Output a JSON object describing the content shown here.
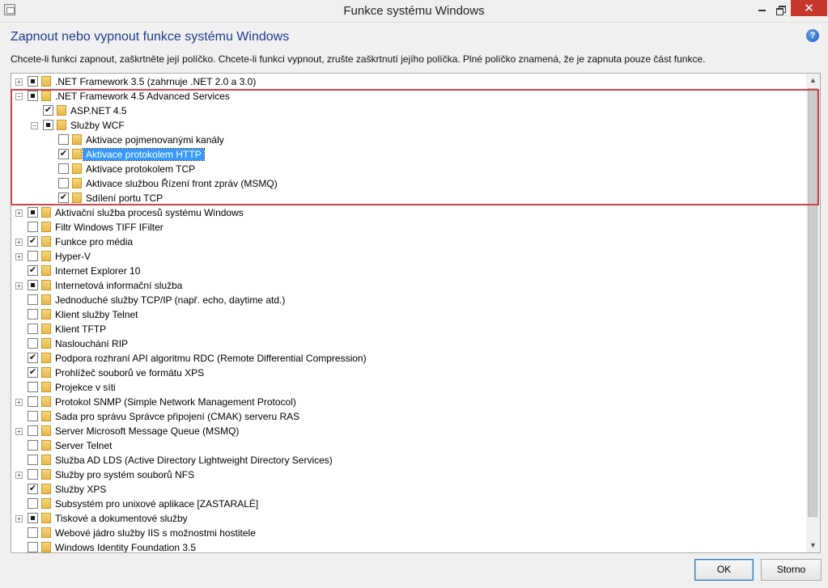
{
  "window": {
    "title": "Funkce systému Windows",
    "close_glyph": "✕"
  },
  "heading": "Zapnout nebo vypnout funkce systému Windows",
  "description": "Chcete-li funkci zapnout, zaškrtněte její políčko. Chcete-li funkci vypnout, zrušte zaškrtnutí jejího políčka. Plné políčko znamená, že je zapnuta pouze část funkce.",
  "help_glyph": "?",
  "tree": {
    "items": [
      {
        "label": ".NET Framework 3.5 (zahrnuje .NET 2.0 a 3.0)",
        "level": 0,
        "expander": "plus",
        "state": "partial"
      },
      {
        "label": ".NET Framework 4.5 Advanced Services",
        "level": 0,
        "expander": "minus",
        "state": "partial"
      },
      {
        "label": "ASP.NET 4.5",
        "level": 1,
        "expander": "none",
        "state": "checked"
      },
      {
        "label": "Služby WCF",
        "level": 1,
        "expander": "minus",
        "state": "partial"
      },
      {
        "label": "Aktivace pojmenovanými kanály",
        "level": 2,
        "expander": "none",
        "state": "unchecked"
      },
      {
        "label": "Aktivace protokolem HTTP",
        "level": 2,
        "expander": "none",
        "state": "checked",
        "selected": true
      },
      {
        "label": "Aktivace protokolem TCP",
        "level": 2,
        "expander": "none",
        "state": "unchecked"
      },
      {
        "label": "Aktivace službou Řízení front zpráv (MSMQ)",
        "level": 2,
        "expander": "none",
        "state": "unchecked"
      },
      {
        "label": "Sdílení portu TCP",
        "level": 2,
        "expander": "none",
        "state": "checked"
      },
      {
        "label": "Aktivační služba procesů systému Windows",
        "level": 0,
        "expander": "plus",
        "state": "partial"
      },
      {
        "label": "Filtr Windows TIFF IFilter",
        "level": 0,
        "expander": "none",
        "state": "unchecked"
      },
      {
        "label": "Funkce pro média",
        "level": 0,
        "expander": "plus",
        "state": "checked"
      },
      {
        "label": "Hyper-V",
        "level": 0,
        "expander": "plus",
        "state": "unchecked"
      },
      {
        "label": "Internet Explorer 10",
        "level": 0,
        "expander": "none",
        "state": "checked"
      },
      {
        "label": "Internetová informační služba",
        "level": 0,
        "expander": "plus",
        "state": "partial"
      },
      {
        "label": "Jednoduché služby TCP/IP (např. echo, daytime atd.)",
        "level": 0,
        "expander": "none",
        "state": "unchecked"
      },
      {
        "label": "Klient služby Telnet",
        "level": 0,
        "expander": "none",
        "state": "unchecked"
      },
      {
        "label": "Klient TFTP",
        "level": 0,
        "expander": "none",
        "state": "unchecked"
      },
      {
        "label": "Naslouchání RIP",
        "level": 0,
        "expander": "none",
        "state": "unchecked"
      },
      {
        "label": "Podpora rozhraní API algoritmu RDC (Remote Differential Compression)",
        "level": 0,
        "expander": "none",
        "state": "checked"
      },
      {
        "label": "Prohlížeč souborů ve formátu XPS",
        "level": 0,
        "expander": "none",
        "state": "checked"
      },
      {
        "label": "Projekce v síti",
        "level": 0,
        "expander": "none",
        "state": "unchecked"
      },
      {
        "label": "Protokol SNMP (Simple Network Management Protocol)",
        "level": 0,
        "expander": "plus",
        "state": "unchecked"
      },
      {
        "label": "Sada pro správu Správce připojení (CMAK) serveru RAS",
        "level": 0,
        "expander": "none",
        "state": "unchecked"
      },
      {
        "label": "Server Microsoft Message Queue (MSMQ)",
        "level": 0,
        "expander": "plus",
        "state": "unchecked"
      },
      {
        "label": "Server Telnet",
        "level": 0,
        "expander": "none",
        "state": "unchecked"
      },
      {
        "label": "Služba AD LDS (Active Directory Lightweight Directory Services)",
        "level": 0,
        "expander": "none",
        "state": "unchecked"
      },
      {
        "label": "Služby pro systém souborů NFS",
        "level": 0,
        "expander": "plus",
        "state": "unchecked"
      },
      {
        "label": "Služby XPS",
        "level": 0,
        "expander": "none",
        "state": "checked"
      },
      {
        "label": "Subsystém pro unixové aplikace [ZASTARALÉ]",
        "level": 0,
        "expander": "none",
        "state": "unchecked"
      },
      {
        "label": "Tiskové a dokumentové služby",
        "level": 0,
        "expander": "plus",
        "state": "partial"
      },
      {
        "label": "Webové jádro služby IIS s možnostmi hostitele",
        "level": 0,
        "expander": "none",
        "state": "unchecked"
      },
      {
        "label": "Windows Identity Foundation 3.5",
        "level": 0,
        "expander": "none",
        "state": "unchecked"
      }
    ]
  },
  "buttons": {
    "ok": "OK",
    "cancel": "Storno"
  },
  "colors": {
    "heading": "#1e3c8c",
    "highlight_box": "#d1434b",
    "selection": "#3399ff",
    "close_button": "#c7372e"
  }
}
